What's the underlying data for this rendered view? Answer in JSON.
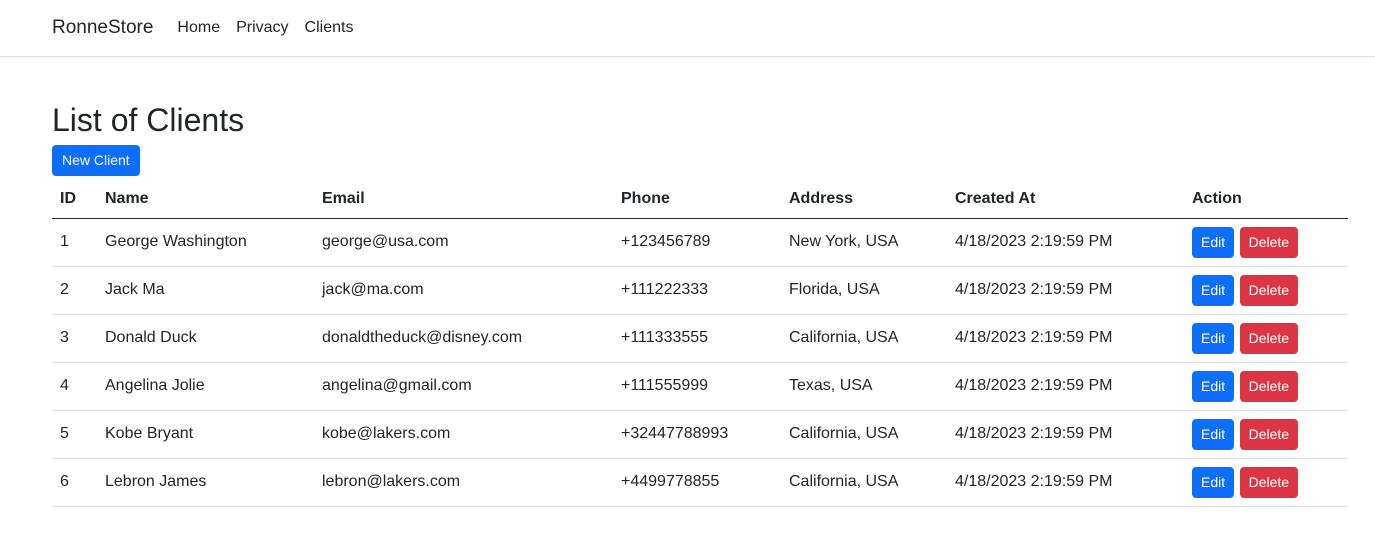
{
  "navbar": {
    "brand": "RonneStore",
    "links": [
      "Home",
      "Privacy",
      "Clients"
    ]
  },
  "page": {
    "title": "List of Clients",
    "new_button": "New Client"
  },
  "table": {
    "headers": [
      "ID",
      "Name",
      "Email",
      "Phone",
      "Address",
      "Created At",
      "Action"
    ],
    "edit_label": "Edit",
    "delete_label": "Delete",
    "rows": [
      {
        "id": "1",
        "name": "George Washington",
        "email": "george@usa.com",
        "phone": "+123456789",
        "address": "New York, USA",
        "created": "4/18/2023 2:19:59 PM"
      },
      {
        "id": "2",
        "name": "Jack Ma",
        "email": "jack@ma.com",
        "phone": "+111222333",
        "address": "Florida, USA",
        "created": "4/18/2023 2:19:59 PM"
      },
      {
        "id": "3",
        "name": "Donald Duck",
        "email": "donaldtheduck@disney.com",
        "phone": "+111333555",
        "address": "California, USA",
        "created": "4/18/2023 2:19:59 PM"
      },
      {
        "id": "4",
        "name": "Angelina Jolie",
        "email": "angelina@gmail.com",
        "phone": "+111555999",
        "address": "Texas, USA",
        "created": "4/18/2023 2:19:59 PM"
      },
      {
        "id": "5",
        "name": "Kobe Bryant",
        "email": "kobe@lakers.com",
        "phone": "+32447788993",
        "address": "California, USA",
        "created": "4/18/2023 2:19:59 PM"
      },
      {
        "id": "6",
        "name": "Lebron James",
        "email": "lebron@lakers.com",
        "phone": "+4499778855",
        "address": "California, USA",
        "created": "4/18/2023 2:19:59 PM"
      }
    ]
  },
  "colors": {
    "primary": "#0d6efd",
    "danger": "#dc3545"
  }
}
